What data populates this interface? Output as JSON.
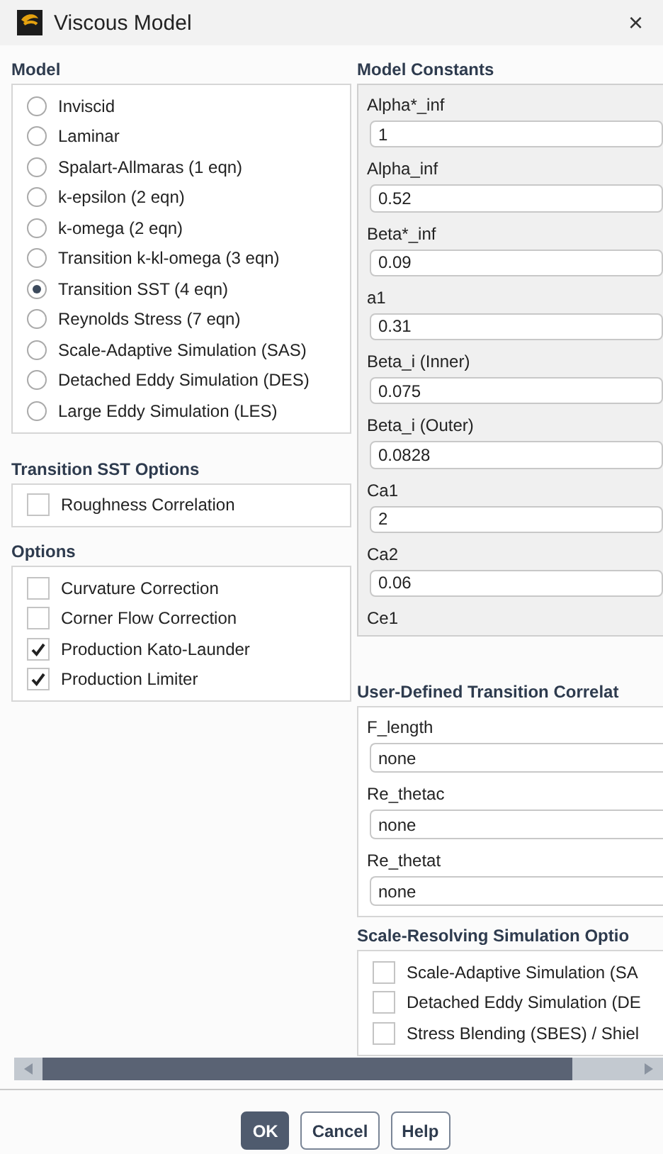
{
  "window": {
    "title": "Viscous Model",
    "close": "×"
  },
  "model": {
    "label": "Model",
    "options": [
      {
        "label": "Inviscid",
        "selected": false
      },
      {
        "label": "Laminar",
        "selected": false
      },
      {
        "label": "Spalart-Allmaras (1 eqn)",
        "selected": false
      },
      {
        "label": "k-epsilon (2 eqn)",
        "selected": false
      },
      {
        "label": "k-omega (2 eqn)",
        "selected": false
      },
      {
        "label": "Transition k-kl-omega (3 eqn)",
        "selected": false
      },
      {
        "label": "Transition SST (4 eqn)",
        "selected": true
      },
      {
        "label": "Reynolds Stress (7 eqn)",
        "selected": false
      },
      {
        "label": "Scale-Adaptive Simulation (SAS)",
        "selected": false
      },
      {
        "label": "Detached Eddy Simulation (DES)",
        "selected": false
      },
      {
        "label": "Large Eddy Simulation (LES)",
        "selected": false
      }
    ]
  },
  "transition_sst_options": {
    "label": "Transition SST Options",
    "items": [
      {
        "label": "Roughness Correlation",
        "checked": false
      }
    ]
  },
  "options": {
    "label": "Options",
    "items": [
      {
        "label": "Curvature Correction",
        "checked": false
      },
      {
        "label": "Corner Flow Correction",
        "checked": false
      },
      {
        "label": "Production Kato-Launder",
        "checked": true
      },
      {
        "label": "Production Limiter",
        "checked": true
      }
    ]
  },
  "model_constants": {
    "label": "Model Constants",
    "items": [
      {
        "label": "Alpha*_inf",
        "value": "1"
      },
      {
        "label": "Alpha_inf",
        "value": "0.52"
      },
      {
        "label": "Beta*_inf",
        "value": "0.09"
      },
      {
        "label": "a1",
        "value": "0.31"
      },
      {
        "label": "Beta_i (Inner)",
        "value": "0.075"
      },
      {
        "label": "Beta_i (Outer)",
        "value": "0.0828"
      },
      {
        "label": "Ca1",
        "value": "2"
      },
      {
        "label": "Ca2",
        "value": "0.06"
      },
      {
        "label": "Ce1"
      }
    ]
  },
  "user_defined_transition": {
    "label": "User-Defined Transition Correlat",
    "items": [
      {
        "label": "F_length",
        "value": "none"
      },
      {
        "label": "Re_thetac",
        "value": "none"
      },
      {
        "label": "Re_thetat",
        "value": "none"
      }
    ]
  },
  "scale_resolving_options": {
    "label": "Scale-Resolving Simulation Optio",
    "items": [
      {
        "label": "Scale-Adaptive Simulation (SA",
        "checked": false
      },
      {
        "label": "Detached Eddy Simulation (DE",
        "checked": false
      },
      {
        "label": "Stress Blending (SBES) / Shiel",
        "checked": false
      }
    ]
  },
  "buttons": [
    {
      "label": "OK",
      "kind": "primary"
    },
    {
      "label": "Cancel",
      "kind": "normal"
    },
    {
      "label": "Help",
      "kind": "normal"
    }
  ]
}
